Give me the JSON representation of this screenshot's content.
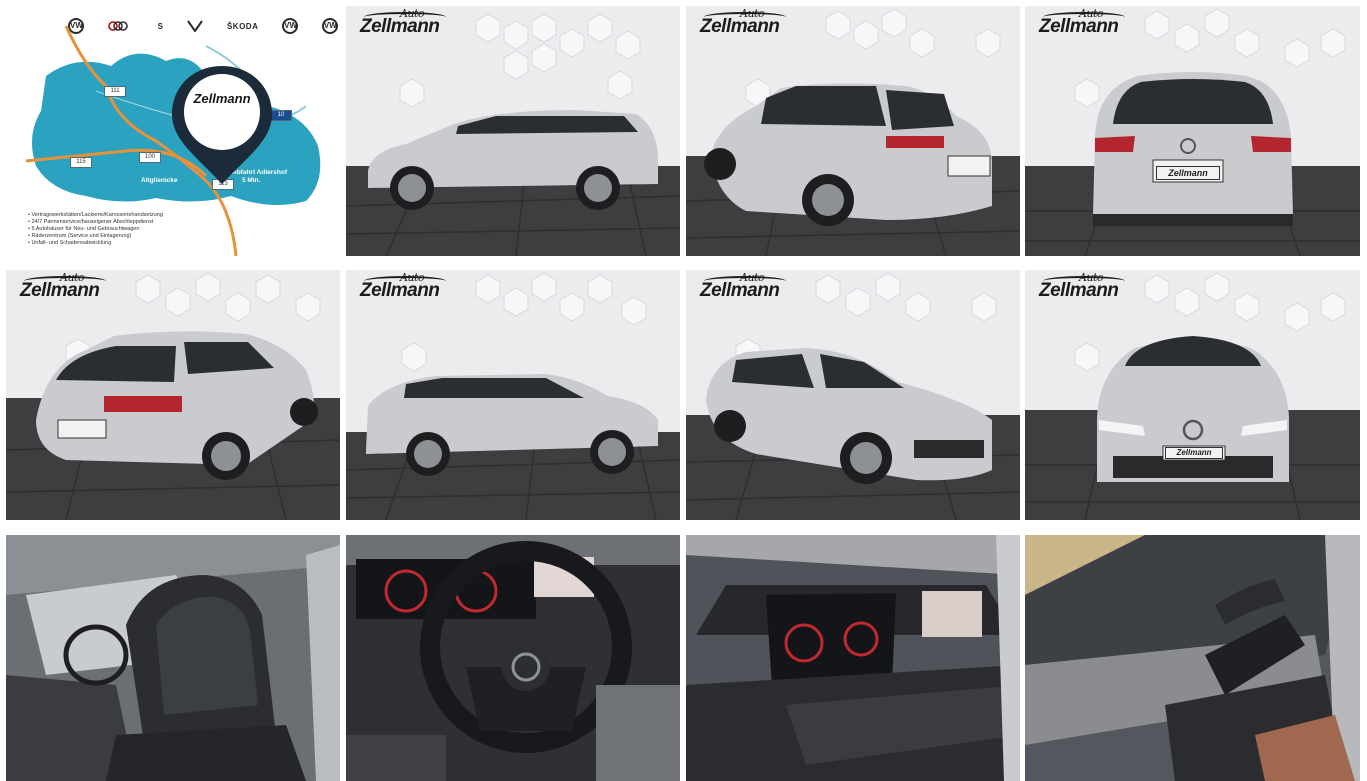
{
  "page": {
    "background": "#ffffff"
  },
  "brand": {
    "name": "Zellmann",
    "script": "Auto"
  },
  "map": {
    "brands": [
      {
        "label": "VW",
        "icon": "vw-logo-icon",
        "caption": ""
      },
      {
        "label": "",
        "icon": "audi-logo-icon",
        "caption": ""
      },
      {
        "label": "S",
        "icon": "seat-logo-icon",
        "caption": ""
      },
      {
        "label": "",
        "icon": "cupra-logo-icon",
        "caption": ""
      },
      {
        "label": "ŠKODA",
        "icon": "skoda-logo-icon",
        "caption": ""
      },
      {
        "label": "VW",
        "icon": "vw-commercial-logo-icon",
        "caption": ""
      },
      {
        "label": "VW",
        "icon": "vw-commercial-vehicles-logo-icon",
        "caption": ""
      }
    ],
    "roads": [
      "111",
      "100",
      "115",
      "113",
      "10"
    ],
    "places": {
      "left": "Altglienicke",
      "right_line1": "Abfahrt Adlershof",
      "right_line2": "5 Min."
    },
    "services": [
      "• Vertragswerkstätten/Lackierei/Karosseriehandsetzung",
      "• 24/7 Pannenservice/hauseigener Abschleppdienst",
      "• 5 Autohäuser für Neu- und Gebrauchtwagen",
      "• Räderzentrum (Service und Einlagerung)",
      "• Unfall- und Schadensabwicklung"
    ],
    "colors": {
      "map_fill": "#2aa2c0",
      "road": "#e8913b",
      "pin": "#1c2b3a"
    }
  },
  "gallery": {
    "photos": [
      {
        "name": "photo-map",
        "view": "map"
      },
      {
        "name": "photo-side-left",
        "view": "side-left"
      },
      {
        "name": "photo-rear-three-quarter-right",
        "view": "rear-right"
      },
      {
        "name": "photo-rear",
        "view": "rear"
      },
      {
        "name": "photo-rear-three-quarter-left",
        "view": "rear-left"
      },
      {
        "name": "photo-side-right",
        "view": "side-right"
      },
      {
        "name": "photo-front-three-quarter",
        "view": "front-left"
      },
      {
        "name": "photo-front",
        "view": "front"
      },
      {
        "name": "photo-interior-seats",
        "view": "seats"
      },
      {
        "name": "photo-steering-wheel",
        "view": "steering"
      },
      {
        "name": "photo-digital-cockpit",
        "view": "cockpit"
      },
      {
        "name": "photo-door-panel",
        "view": "door"
      }
    ],
    "colors": {
      "wall": "#ececef",
      "floor": "#3e3e40",
      "car": "#c9cbcf",
      "glass": "#2a2e33"
    }
  }
}
